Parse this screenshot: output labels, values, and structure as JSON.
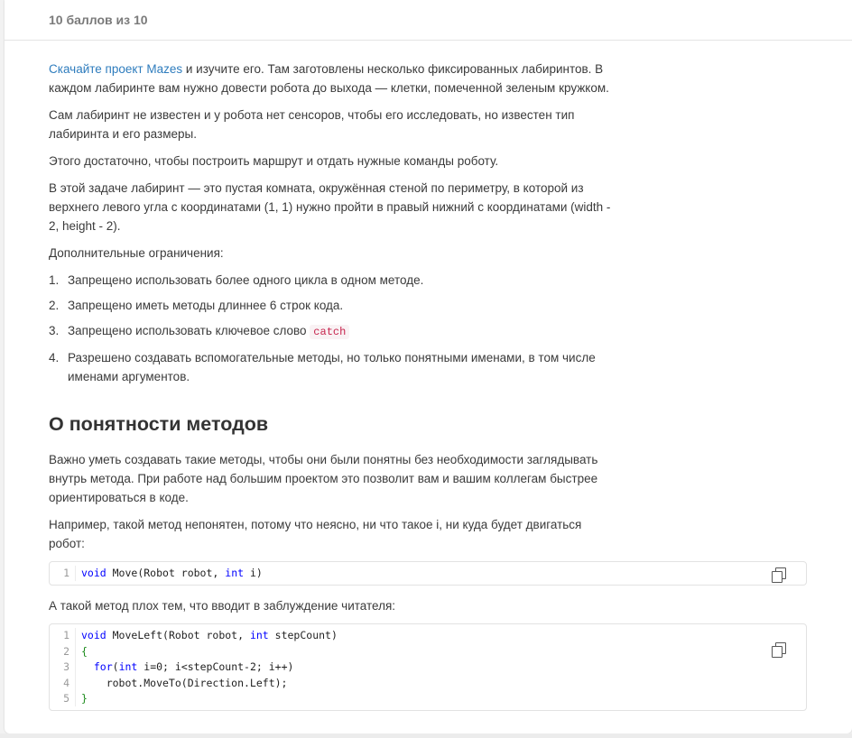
{
  "header": {
    "score": "10 баллов из 10"
  },
  "intro": {
    "link_text": "Скачайте проект Mazes",
    "p1_rest": " и изучите его. Там заготовлены несколько фиксированных лабиринтов. В каждом лабиринте вам нужно довести робота до выхода — клетки, помеченной зеленым кружком.",
    "p2": "Сам лабиринт не известен и у робота нет сенсоров, чтобы его исследовать, но известен тип лабиринта и его размеры.",
    "p3": "Этого достаточно, чтобы построить маршрут и отдать нужные команды роботу.",
    "p4": "В этой задаче лабиринт — это пустая комната, окружённая стеной по периметру, в которой из верхнего левого угла с координатами (1, 1) нужно пройти в правый нижний с координатами (width - 2, height - 2).",
    "p5": "Дополнительные ограничения:"
  },
  "constraints": {
    "items": [
      {
        "num": "1.",
        "text": "Запрещено использовать более одного цикла в одном методе."
      },
      {
        "num": "2.",
        "text": "Запрещено иметь методы длиннее 6 строк кода."
      },
      {
        "num": "3.",
        "text": "Запрещено использовать ключевое слово "
      },
      {
        "num": "4.",
        "text": "Разрешено создавать вспомогательные методы, но только понятными именами, в том числе именами аргументов."
      }
    ],
    "keyword": "catch"
  },
  "section": {
    "title": "О понятности методов",
    "p1": "Важно уметь создавать такие методы, чтобы они были понятны без необходимости заглядывать внутрь метода. При работе над большим проектом это позволит вам и вашим коллегам быстрее ориентироваться в коде.",
    "p2": "Например, такой метод непонятен, потому что неясно, ни что такое i, ни куда будет двигаться робот:",
    "p3": "А такой метод плох тем, что вводит в заблуждение читателя:"
  },
  "code1": {
    "lines": [
      {
        "n": "1",
        "t": "void Move(Robot robot, int i)"
      }
    ]
  },
  "code2": {
    "lines": [
      {
        "n": "1",
        "t": "void MoveLeft(Robot robot, int stepCount)"
      },
      {
        "n": "2",
        "t": "{"
      },
      {
        "n": "3",
        "t": "  for(int i=0; i<stepCount-2; i++)"
      },
      {
        "n": "4",
        "t": "    robot.MoveTo(Direction.Left);"
      },
      {
        "n": "5",
        "t": "}"
      }
    ]
  },
  "colors": {
    "link": "#2e7cbd",
    "keyword": "#0000ff",
    "brace": "#1a8a1a",
    "inline_code": "#c7254e"
  },
  "icons": {
    "copy": "copy-icon"
  }
}
